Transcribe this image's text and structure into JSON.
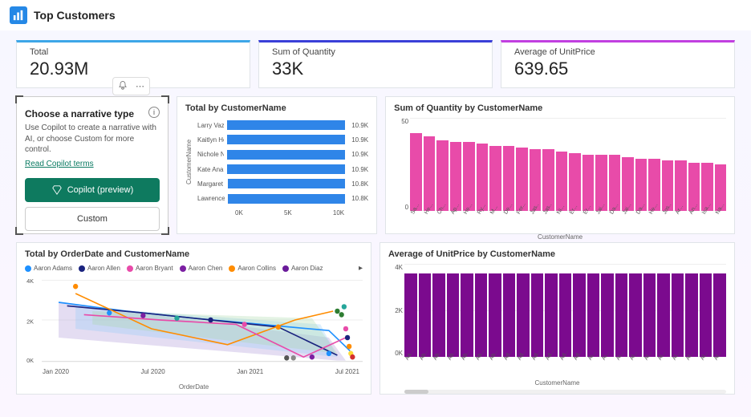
{
  "header": {
    "title": "Top Customers"
  },
  "kpis": [
    {
      "label": "Total",
      "value": "20.93M",
      "border": "#3da6e8"
    },
    {
      "label": "Sum of Quantity",
      "value": "33K",
      "border": "#3a3fd8"
    },
    {
      "label": "Average of UnitPrice",
      "value": "639.65",
      "border": "#c13fe0"
    }
  ],
  "narrative": {
    "heading": "Choose a narrative type",
    "body": "Use Copilot to create a narrative with AI, or choose Custom for more control.",
    "link": "Read Copilot terms",
    "primary_btn": "Copilot (preview)",
    "secondary_btn": "Custom"
  },
  "chart_data": [
    {
      "id": "hbar",
      "type": "bar",
      "title": "Total by CustomerName",
      "ylabel": "CustomerName",
      "xlim": [
        0,
        11000
      ],
      "xticks": [
        "0K",
        "5K",
        "10K"
      ],
      "categories": [
        "Larry Vaz...",
        "Kaitlyn He...",
        "Nichole N...",
        "Kate Anand",
        "Margaret ...",
        "Lawrence ..."
      ],
      "values": [
        10900,
        10900,
        10900,
        10900,
        10800,
        10800
      ],
      "labels": [
        "10.9K",
        "10.9K",
        "10.9K",
        "10.9K",
        "10.8K",
        "10.8K"
      ]
    },
    {
      "id": "vbar_qty",
      "type": "bar",
      "title": "Sum of Quantity by CustomerName",
      "ylim": [
        0,
        50
      ],
      "yticks": [
        "50",
        "0"
      ],
      "xlabel": "CustomerName",
      "color": "#e84ba9",
      "categories": [
        "Sa...",
        "He...",
        "Ch...",
        "Ap...",
        "He...",
        "Ry...",
        "M...",
        "De...",
        "Fer...",
        "Jas...",
        "Jas...",
        "Ni...",
        "Er...",
        "Er...",
        "Jai...",
        "Da...",
        "Jai...",
        "Da...",
        "He...",
        "Jos...",
        "Ar...",
        "An...",
        "Isa...",
        "Na..."
      ],
      "values": [
        42,
        40,
        38,
        37,
        37,
        36,
        35,
        35,
        34,
        33,
        33,
        32,
        31,
        30,
        30,
        30,
        29,
        28,
        28,
        27,
        27,
        26,
        26,
        25
      ]
    },
    {
      "id": "line",
      "type": "line",
      "title": "Total by OrderDate and CustomerName",
      "xlabel": "OrderDate",
      "ylim": [
        0,
        4000
      ],
      "yticks": [
        "4K",
        "2K",
        "0K"
      ],
      "xticks": [
        "Jan 2020",
        "Jul 2020",
        "Jan 2021",
        "Jul 2021"
      ],
      "series": [
        {
          "name": "Aaron Adams",
          "color": "#1e90ff"
        },
        {
          "name": "Aaron Allen",
          "color": "#1a237e"
        },
        {
          "name": "Aaron Bryant",
          "color": "#e84ba9"
        },
        {
          "name": "Aaron Chen",
          "color": "#7b1fa2"
        },
        {
          "name": "Aaron Collins",
          "color": "#ff8c00"
        },
        {
          "name": "Aaron Diaz",
          "color": "#6a1b9a"
        }
      ]
    },
    {
      "id": "vbar_avg",
      "type": "bar",
      "title": "Average of UnitPrice by CustomerName",
      "ylim": [
        0,
        4000
      ],
      "yticks": [
        "4K",
        "2K",
        "0K"
      ],
      "xlabel": "CustomerName",
      "color": "#7b0a8e",
      "categories": [
        "Aa...",
        "Ab...",
        "Ab...",
        "Ab...",
        "Ab...",
        "Ab...",
        "Ab...",
        "Ad...",
        "Ad...",
        "Ad...",
        "Ad...",
        "Ad...",
        "Ad...",
        "Ai...",
        "Ai...",
        "Ai...",
        "Al...",
        "Al...",
        "Al...",
        "Al...",
        "Al...",
        "Al...",
        "Al..."
      ],
      "values": [
        3600,
        3600,
        3600,
        3600,
        3600,
        3600,
        3600,
        3600,
        3600,
        3600,
        3600,
        3600,
        3600,
        3600,
        3600,
        3600,
        3600,
        3600,
        3600,
        3600,
        3600,
        3600,
        3600
      ]
    }
  ]
}
